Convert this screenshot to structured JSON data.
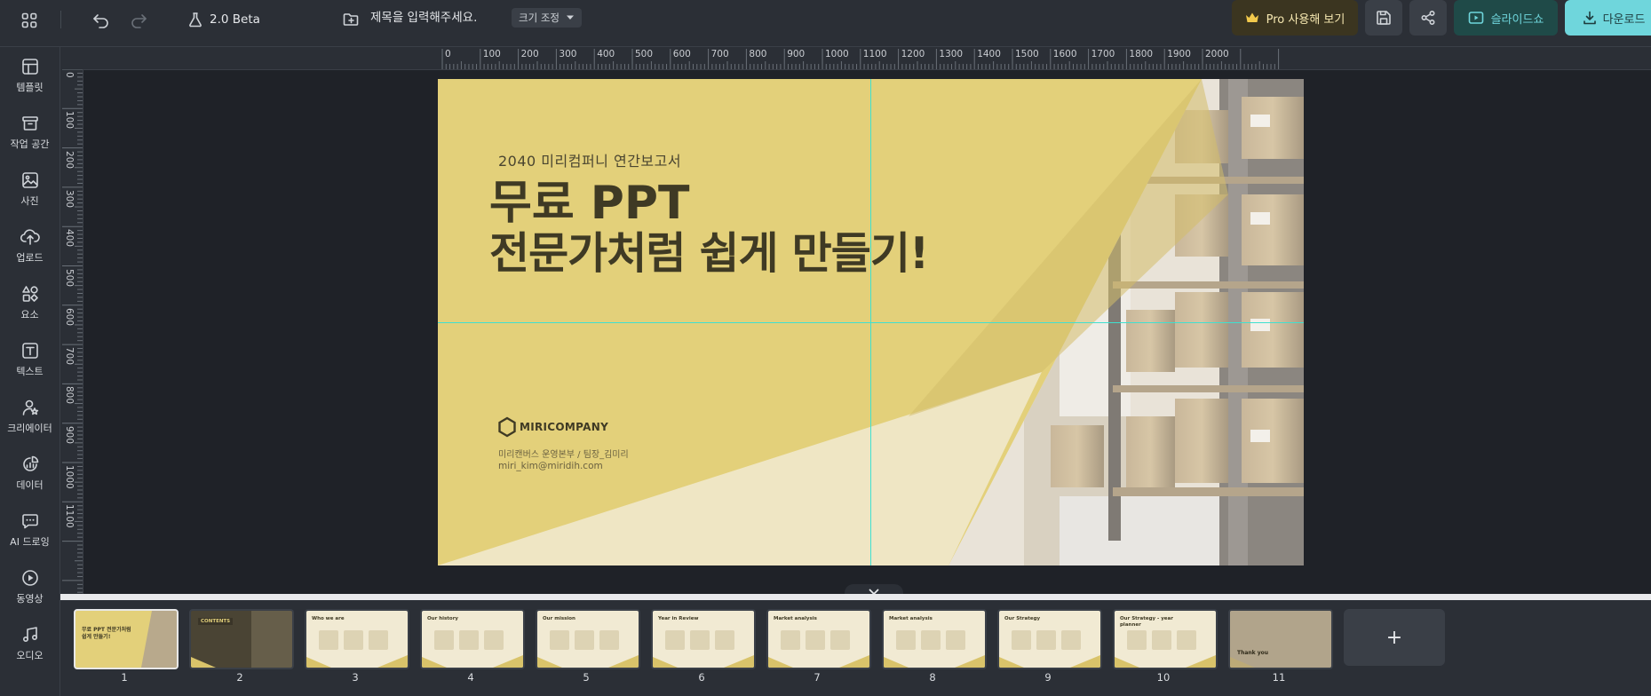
{
  "topbar": {
    "version_label": "2.0 Beta",
    "title_placeholder": "제목을 입력해주세요.",
    "resize_label": "크기 조정",
    "pro_label": "Pro 사용해 보기",
    "slideshow_label": "슬라이드쇼",
    "download_label": "다운로드"
  },
  "sidebar": {
    "items": [
      {
        "label": "템플릿",
        "icon": "template-icon"
      },
      {
        "label": "작업 공간",
        "icon": "workspace-icon"
      },
      {
        "label": "사진",
        "icon": "photo-icon"
      },
      {
        "label": "업로드",
        "icon": "upload-icon"
      },
      {
        "label": "요소",
        "icon": "elements-icon"
      },
      {
        "label": "텍스트",
        "icon": "text-icon"
      },
      {
        "label": "크리에이터",
        "icon": "creator-icon"
      },
      {
        "label": "데이터",
        "icon": "data-icon"
      },
      {
        "label": "AI 드로잉",
        "icon": "ai-drawing-icon"
      },
      {
        "label": "동영상",
        "icon": "video-icon"
      },
      {
        "label": "오디오",
        "icon": "audio-icon"
      }
    ]
  },
  "ruler": {
    "top": [
      "0",
      "100",
      "200",
      "300",
      "400",
      "500",
      "600",
      "700",
      "800",
      "900",
      "1000",
      "1100",
      "1200",
      "1300",
      "1400",
      "1500",
      "1600",
      "1700",
      "1800",
      "1900",
      "2000"
    ],
    "left": [
      "0",
      "100",
      "200",
      "300",
      "400",
      "500",
      "600",
      "700",
      "800",
      "900",
      "1000",
      "1100"
    ]
  },
  "slide": {
    "subtitle": "2040 미리컴퍼니 연간보고서",
    "title_line1": "무료 PPT",
    "title_line2": "전문가처럼 쉽게 만들기!",
    "company": "MIRICOMPANY",
    "dept": "미리캔버스 운영본부 / 팀장_김미리",
    "email": "miri_kim@miridih.com"
  },
  "thumbnails": [
    {
      "num": "1",
      "caption": "무료 PPT 전문가처럼 쉽게 만들기!",
      "style": "cover"
    },
    {
      "num": "2",
      "caption": "CONTENTS",
      "style": "dark"
    },
    {
      "num": "3",
      "caption": "Who we are",
      "style": "light"
    },
    {
      "num": "4",
      "caption": "Our history",
      "style": "light"
    },
    {
      "num": "5",
      "caption": "Our mission",
      "style": "light"
    },
    {
      "num": "6",
      "caption": "Year in Review",
      "style": "light"
    },
    {
      "num": "7",
      "caption": "Market analysis",
      "style": "light"
    },
    {
      "num": "8",
      "caption": "Market analysis",
      "style": "light"
    },
    {
      "num": "9",
      "caption": "Our Strategy",
      "style": "light"
    },
    {
      "num": "10",
      "caption": "Our Strategy - year planner",
      "style": "light"
    },
    {
      "num": "11",
      "caption": "Thank you",
      "style": "warehouse"
    }
  ],
  "add_slide_symbol": "+",
  "colors": {
    "slide_yellow": "#e3d07a",
    "pro_bg": "#3b3520",
    "pro_text": "#f2d46a",
    "slideshow_bg": "#1f4a48",
    "download_bg": "#6fd6dc",
    "guide": "#3fe0d0"
  }
}
